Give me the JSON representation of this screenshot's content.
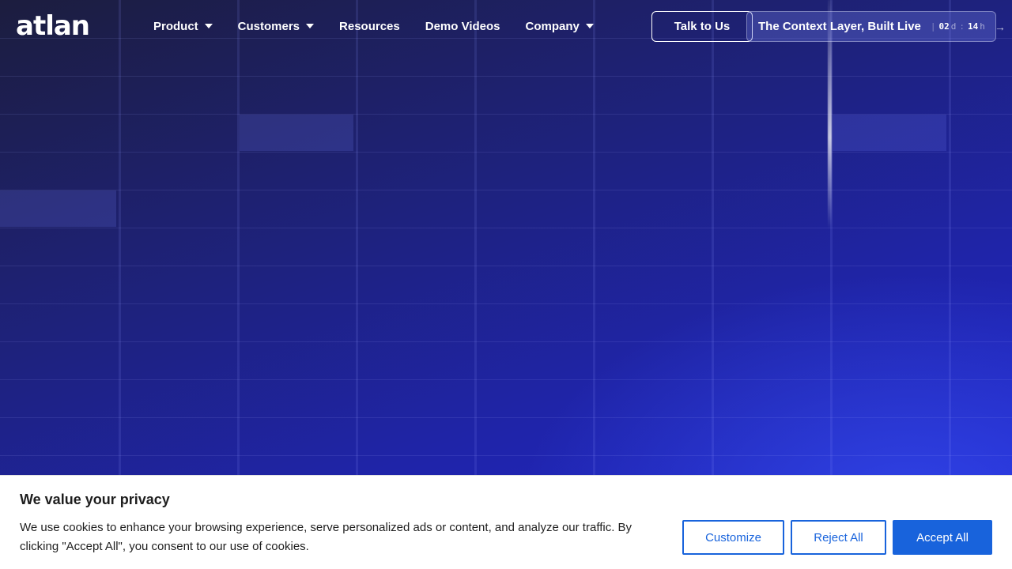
{
  "brand": {
    "logo_text": "atlan"
  },
  "nav": {
    "items": [
      {
        "label": "Product",
        "has_dropdown": true
      },
      {
        "label": "Customers",
        "has_dropdown": true
      },
      {
        "label": "Resources",
        "has_dropdown": false
      },
      {
        "label": "Demo Videos",
        "has_dropdown": false
      },
      {
        "label": "Company",
        "has_dropdown": true
      }
    ],
    "cta_talk": "Talk to Us",
    "event": {
      "label": "The Context Layer, Built Live",
      "days_value": "02",
      "days_unit": "d",
      "hours_value": "14",
      "hours_unit": "h",
      "separator_left": "|",
      "separator_mid": ":",
      "arrow_icon": "arrow-right-icon"
    }
  },
  "cookie_banner": {
    "title": "We value your privacy",
    "text": "We use cookies to enhance your browsing experience, serve personalized ads or content, and analyze our traffic. By clicking \"Accept All\", you consent to our use of cookies.",
    "customize_label": "Customize",
    "reject_label": "Reject All",
    "accept_label": "Accept All"
  },
  "colors": {
    "hero_gradient_start": "#1c1d3e",
    "hero_gradient_end": "#2126d6",
    "cookie_accent": "#1863dc"
  }
}
